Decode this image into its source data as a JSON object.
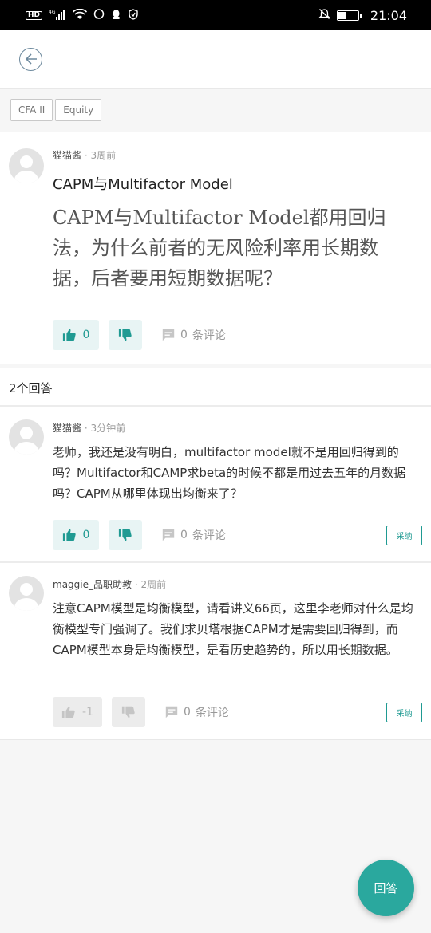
{
  "status_bar": {
    "left_icons": [
      "hd-icon",
      "signal-icon",
      "wifi-icon",
      "chat-icon",
      "qq-icon",
      "shield-icon"
    ],
    "signal_label": "4G",
    "hd_label": "HD",
    "time": "21:04"
  },
  "tags": [
    "CFA II",
    "Equity"
  ],
  "question": {
    "author": "猫猫酱",
    "time": "· 3周前",
    "title": "CAPM与Multifactor Model",
    "body": "CAPM与Multifactor Model都用回归法，为什么前者的无风险利率用长期数据，后者要用短期数据呢？",
    "upvotes": "0",
    "comments": "0",
    "comments_label": "条评论"
  },
  "answers_header": "2个回答",
  "answers": [
    {
      "author": "猫猫酱",
      "time": "· 3分钟前",
      "body": "老师，我还是没有明白，multifactor model就不是用回归得到的吗？Multifactor和CAMP求beta的时候不都是用过去五年的月数据吗？CAPM从哪里体现出均衡来了？",
      "upvotes": "0",
      "comments": "0",
      "comments_label": "条评论",
      "accept_label": "采纳",
      "votes_disabled": false
    },
    {
      "author": "maggie_品职助教",
      "time": "· 2周前",
      "body": "注意CAPM模型是均衡模型，请看讲义66页，这里李老师对什么是均衡模型专门强调了。我们求贝塔根据CAPM才是需要回归得到，而CAPM模型本身是均衡模型，是看历史趋势的，所以用长期数据。",
      "upvotes": "-1",
      "comments": "0",
      "comments_label": "条评论",
      "accept_label": "采纳",
      "votes_disabled": true
    }
  ],
  "fab_label": "回答",
  "colors": {
    "accent": "#2aa89e",
    "vote_bg": "#e8f4f4",
    "page_bg": "#f6f6f6"
  }
}
